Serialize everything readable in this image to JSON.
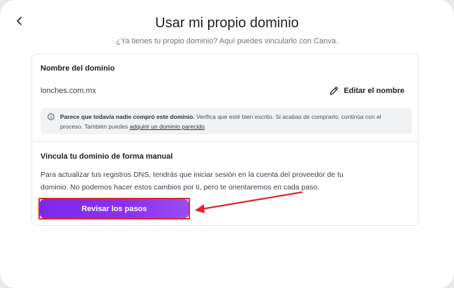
{
  "dialog": {
    "title": "Usar mi propio dominio",
    "subtitle": "¿Ya tienes tu propio dominio? Aquí puedes vincularlo con Canva."
  },
  "domain_section": {
    "label": "Nombre del dominio",
    "domain": "lonches.com.mx",
    "edit_label": "Editar el nombre"
  },
  "alert": {
    "bold_text": "Parece que todavía nadie compró este dominio.",
    "text": " Verifica que esté bien escrito. Si acabas de comprarlo, continúa con el proceso. También puedes ",
    "link_text": "adquirir un dominio parecido",
    "end_text": "."
  },
  "manual_section": {
    "label": "Vincula tu dominio de forma manual",
    "description": "Para actualizar tus registros DNS, tendrás que iniciar sesión en la cuenta del proveedor de tu dominio. No podemos hacer estos cambios por ti, pero te orientaremos en cada paso.",
    "button_label": "Revisar los pasos"
  },
  "colors": {
    "accent": "#7d2ae8",
    "annotation": "#e0242a"
  },
  "icons": {
    "back": "chevron-left-icon",
    "edit": "pencil-icon",
    "info": "info-circle-icon"
  }
}
